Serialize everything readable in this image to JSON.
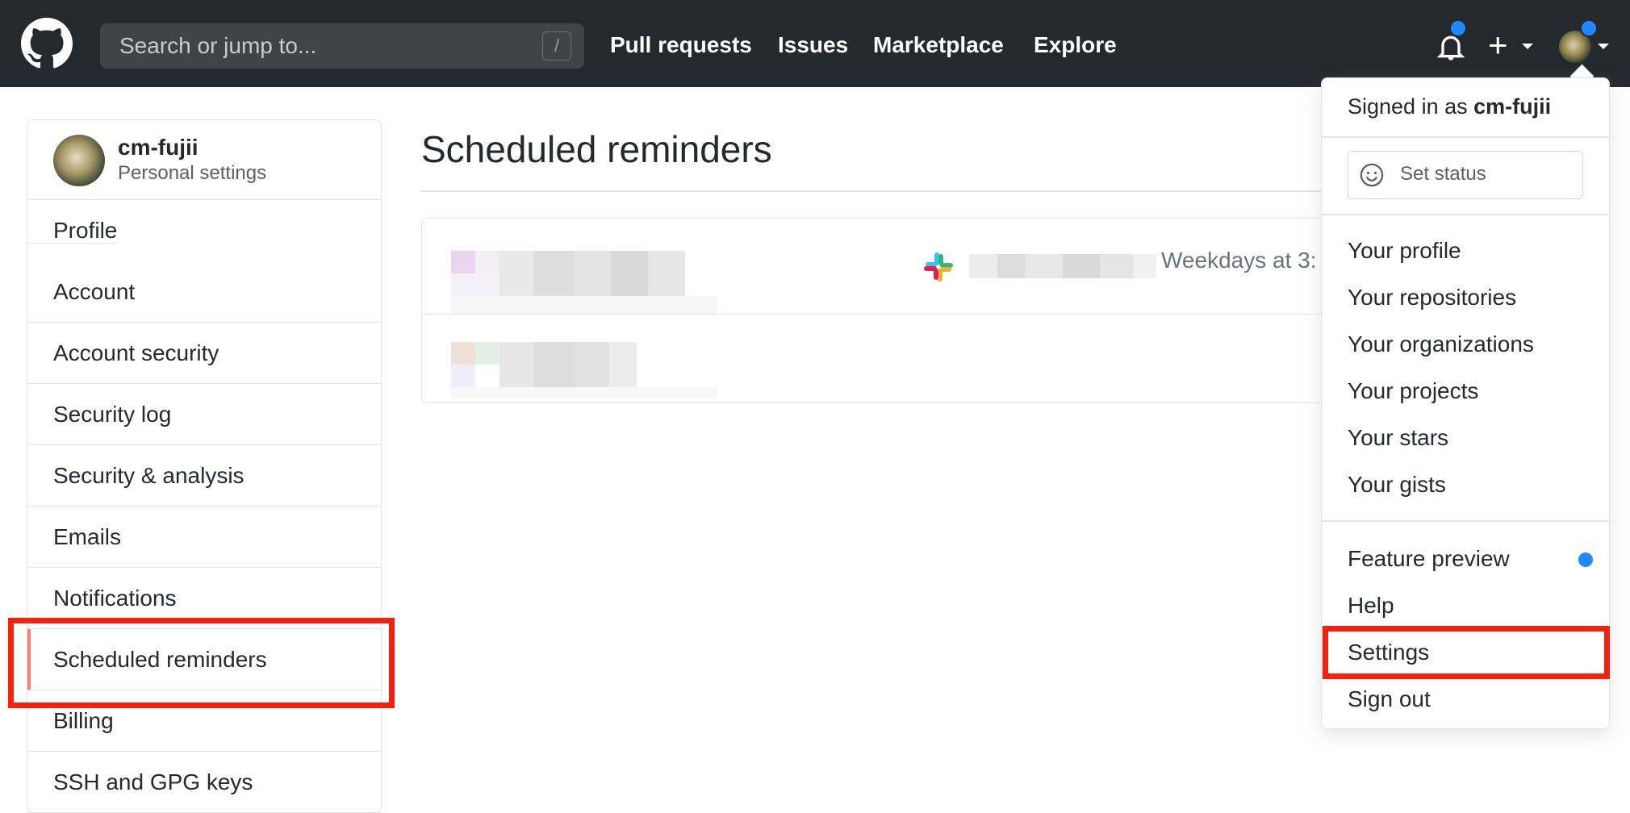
{
  "header": {
    "search_placeholder": "Search or jump to...",
    "search_shortcut": "/",
    "nav": [
      "Pull requests",
      "Issues",
      "Marketplace",
      "Explore"
    ],
    "plus_glyph": "+",
    "accent": "#2188ff"
  },
  "sidebar": {
    "username": "cm-fujii",
    "subtitle": "Personal settings",
    "items": [
      {
        "label": "Profile"
      },
      {
        "label": "Account"
      },
      {
        "label": "Account security"
      },
      {
        "label": "Security log"
      },
      {
        "label": "Security & analysis"
      },
      {
        "label": "Emails"
      },
      {
        "label": "Notifications"
      },
      {
        "label": "Scheduled reminders",
        "selected": true
      },
      {
        "label": "Billing"
      },
      {
        "label": "SSH and GPG keys"
      }
    ]
  },
  "main": {
    "title": "Scheduled reminders",
    "reminders": [
      {
        "schedule": "Weekdays at 3:",
        "integration_icon": "slack-icon"
      },
      {
        "schedule": ""
      }
    ]
  },
  "dropdown": {
    "signed_in_prefix": "Signed in as ",
    "signed_in_user": "cm-fujii",
    "set_status": "Set status",
    "group1": [
      "Your profile",
      "Your repositories",
      "Your organizations",
      "Your projects",
      "Your stars",
      "Your gists"
    ],
    "group2": [
      "Feature preview",
      "Help",
      "Settings",
      "Sign out"
    ]
  },
  "highlight_color": "#f4220b"
}
